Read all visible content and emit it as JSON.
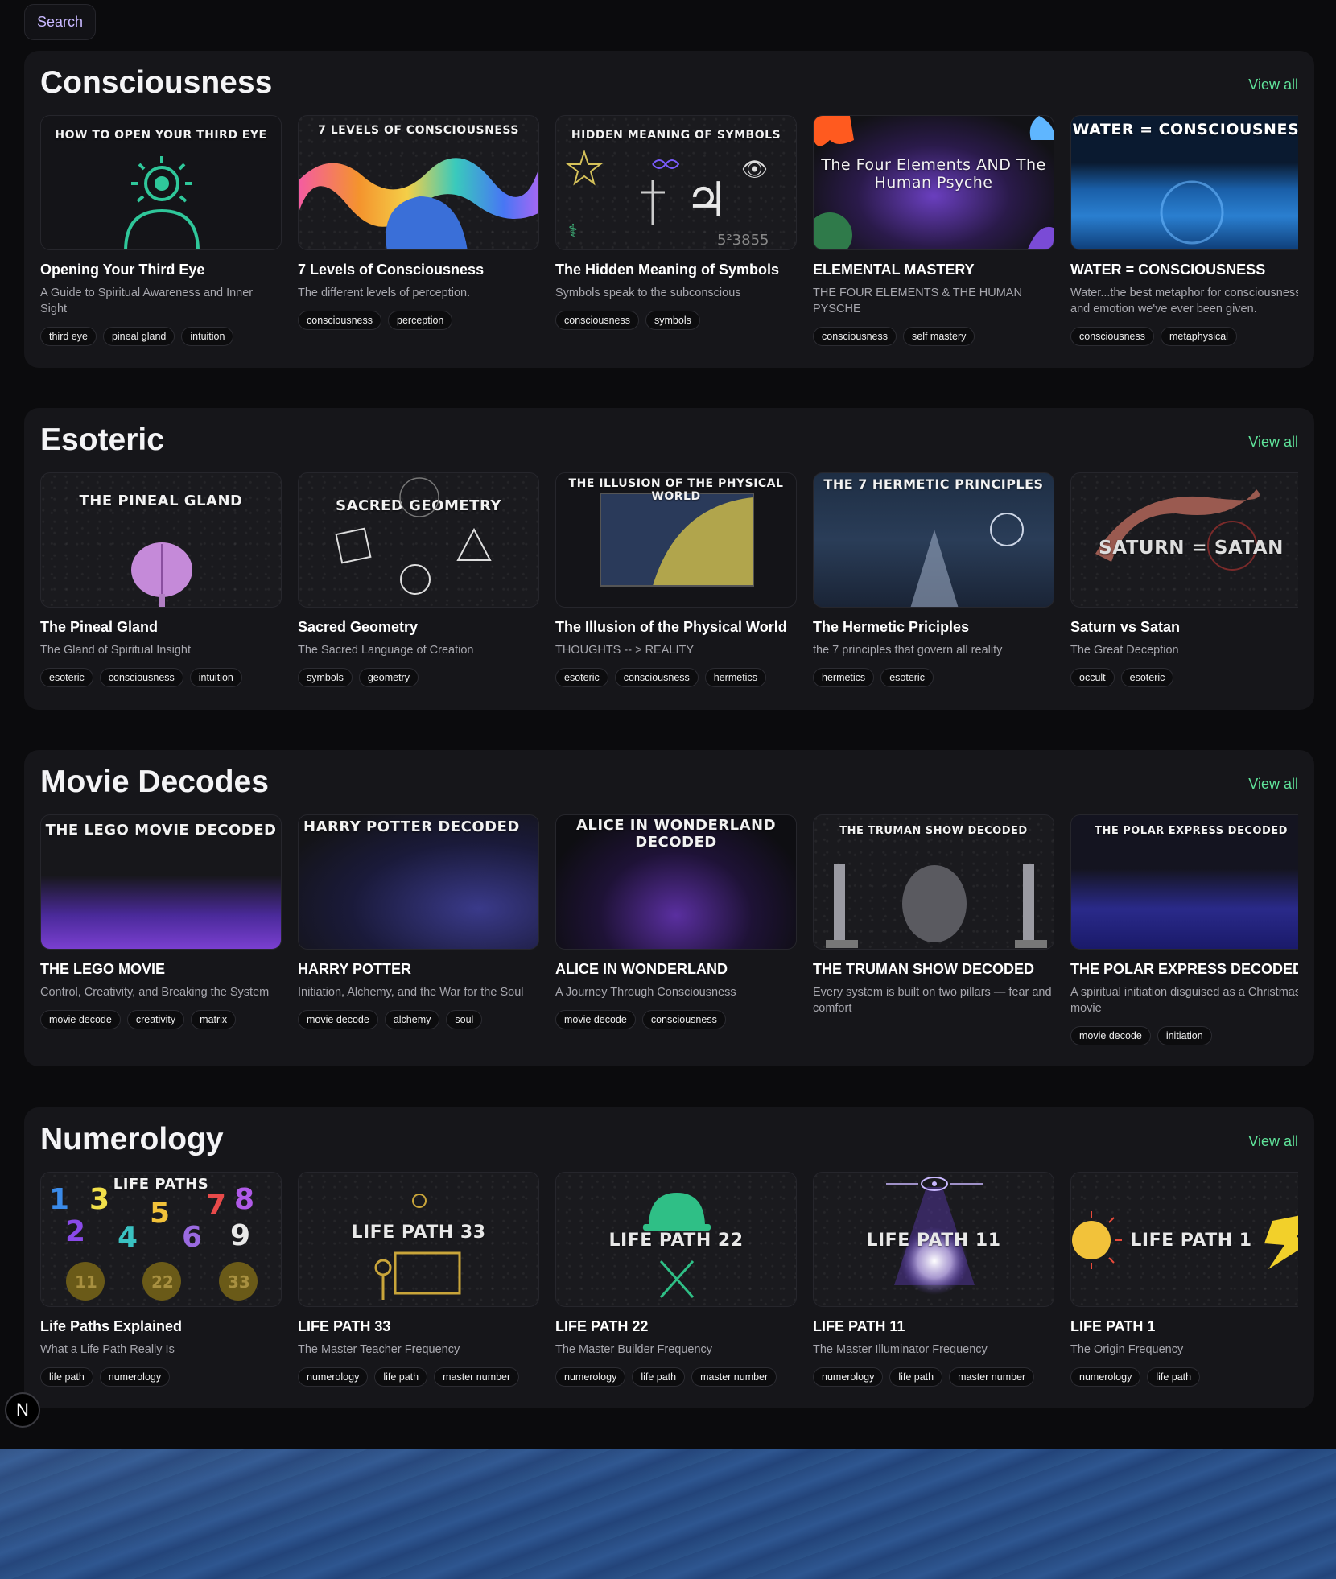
{
  "search": {
    "label": "Search"
  },
  "view_all_label": "View all",
  "sections": [
    {
      "title": "Consciousness",
      "cards": [
        {
          "thumb": "HOW TO OPEN YOUR THIRD EYE",
          "title": "Opening Your Third Eye",
          "subtitle": "A Guide to Spiritual Awareness and Inner Sight",
          "tags": [
            "third eye",
            "pineal gland",
            "intuition"
          ]
        },
        {
          "thumb": "7 LEVELS OF CONSCIOUSNESS",
          "title": "7 Levels of Consciousness",
          "subtitle": "The different levels of perception.",
          "tags": [
            "consciousness",
            "perception"
          ]
        },
        {
          "thumb": "HIDDEN MEANING OF SYMBOLS",
          "title": "The Hidden Meaning of Symbols",
          "subtitle": "Symbols speak to the subconscious",
          "tags": [
            "consciousness",
            "symbols"
          ]
        },
        {
          "thumb": "The Four Elements AND The Human Psyche",
          "title": "ELEMENTAL MASTERY",
          "subtitle": "THE FOUR ELEMENTS & THE HUMAN PYSCHE",
          "tags": [
            "consciousness",
            "self mastery"
          ]
        },
        {
          "thumb": "WATER = CONSCIOUSNESS",
          "title": "WATER = CONSCIOUSNESS",
          "subtitle": "Water...the best metaphor for consciousness and emotion we've ever been given.",
          "tags": [
            "consciousness",
            "metaphysical"
          ]
        }
      ]
    },
    {
      "title": "Esoteric",
      "cards": [
        {
          "thumb": "THE PINEAL GLAND",
          "title": "The Pineal Gland",
          "subtitle": "The Gland of Spiritual Insight",
          "tags": [
            "esoteric",
            "consciousness",
            "intuition"
          ]
        },
        {
          "thumb": "SACRED GEOMETRY",
          "title": "Sacred Geometry",
          "subtitle": "The Sacred Language of Creation",
          "tags": [
            "symbols",
            "geometry"
          ]
        },
        {
          "thumb": "THE ILLUSION OF THE PHYSICAL WORLD",
          "title": "The Illusion of the Physical World",
          "subtitle": "THOUGHTS -- > REALITY",
          "tags": [
            "esoteric",
            "consciousness",
            "hermetics"
          ]
        },
        {
          "thumb": "THE 7 HERMETIC PRINCIPLES",
          "title": "The Hermetic Priciples",
          "subtitle": "the 7 principles that govern all reality",
          "tags": [
            "hermetics",
            "esoteric"
          ]
        },
        {
          "thumb": "SATURN = SATAN",
          "title": "Saturn vs Satan",
          "subtitle": "The Great Deception",
          "tags": [
            "occult",
            "esoteric"
          ]
        }
      ]
    },
    {
      "title": "Movie Decodes",
      "cards": [
        {
          "thumb": "THE LEGO MOVIE DECODED",
          "title": "THE LEGO MOVIE",
          "subtitle": "Control, Creativity, and Breaking the System",
          "tags": [
            "movie decode",
            "creativity",
            "matrix"
          ]
        },
        {
          "thumb": "HARRY POTTER DECODED",
          "title": "HARRY POTTER",
          "subtitle": "Initiation, Alchemy, and the War for the Soul",
          "tags": [
            "movie decode",
            "alchemy",
            "soul"
          ]
        },
        {
          "thumb": "ALICE IN WONDERLAND DECODED",
          "title": "ALICE IN WONDERLAND",
          "subtitle": "A Journey Through Consciousness",
          "tags": [
            "movie decode",
            "consciousness"
          ]
        },
        {
          "thumb": "THE TRUMAN SHOW DECODED",
          "title": "THE TRUMAN SHOW DECODED",
          "subtitle": "Every system is built on two pillars — fear and comfort",
          "tags": []
        },
        {
          "thumb": "THE POLAR EXPRESS DECODED",
          "title": "THE POLAR EXPRESS DECODED",
          "subtitle": "A spiritual initiation disguised as a Christmas movie",
          "tags": [
            "movie decode",
            "initiation"
          ]
        }
      ]
    },
    {
      "title": "Numerology",
      "cards": [
        {
          "thumb": "LIFE PATHS",
          "title": "Life Paths Explained",
          "subtitle": "What a Life Path Really Is",
          "tags": [
            "life path",
            "numerology"
          ]
        },
        {
          "thumb": "LIFE PATH 33",
          "title": "LIFE PATH 33",
          "subtitle": "The Master Teacher Frequency",
          "tags": [
            "numerology",
            "life path",
            "master number"
          ]
        },
        {
          "thumb": "LIFE PATH 22",
          "title": "LIFE PATH 22",
          "subtitle": "The Master Builder Frequency",
          "tags": [
            "numerology",
            "life path",
            "master number"
          ]
        },
        {
          "thumb": "LIFE PATH 11",
          "title": "LIFE PATH 11",
          "subtitle": "The Master Illuminator Frequency",
          "tags": [
            "numerology",
            "life path",
            "master number"
          ]
        },
        {
          "thumb": "LIFE PATH 1",
          "title": "LIFE PATH 1",
          "subtitle": "The Origin Frequency",
          "tags": [
            "numerology",
            "life path"
          ]
        }
      ]
    }
  ],
  "badge": {
    "label": "N"
  },
  "colors": {
    "accent_green": "#5fe39a",
    "search_text": "#c8b8ff",
    "background": "#0b0b0d",
    "panel": "#16161a"
  }
}
